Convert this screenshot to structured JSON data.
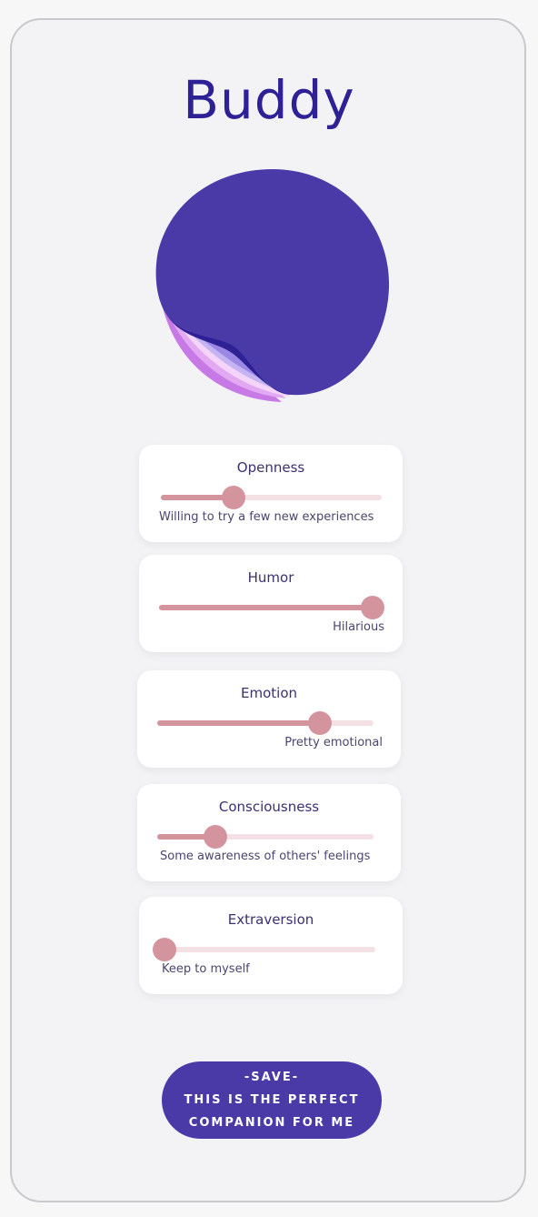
{
  "app": {
    "title": "Buddy"
  },
  "colors": {
    "accent": "#4a3aa8",
    "title": "#2e2196",
    "slider_fill": "#d4949e",
    "slider_track": "#f3e1e6"
  },
  "traits": [
    {
      "label": "Openness",
      "value": 0.33,
      "description": "Willing to try a few new experiences",
      "desc_align": "left"
    },
    {
      "label": "Humor",
      "value": 1.0,
      "description": "Hilarious",
      "desc_align": "right"
    },
    {
      "label": "Emotion",
      "value": 0.75,
      "description": "Pretty emotional",
      "desc_align": "right"
    },
    {
      "label": "Consciousness",
      "value": 0.27,
      "description": "Some awareness of others' feelings",
      "desc_align": "left"
    },
    {
      "label": "Extraversion",
      "value": 0.0,
      "description": "Keep to myself",
      "desc_align": "left"
    }
  ],
  "save_button": {
    "line1": "-SAVE-",
    "line2": "THIS IS THE PERFECT",
    "line3": "COMPANION FOR ME"
  }
}
